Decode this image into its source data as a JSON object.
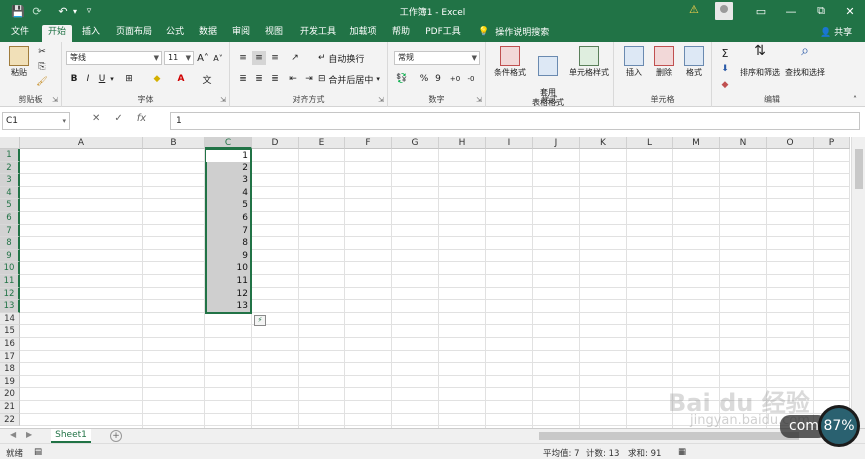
{
  "titlebar": {
    "title": "工作簿1 - Excel",
    "save_icon": "save-icon",
    "undo_icon": "undo-icon",
    "redo_icon": "redo-icon",
    "customize_icon": "customize-icon",
    "restore_label": "⧉",
    "minimize_label": "—",
    "close_label": "✕",
    "ribbon_display_label": "▭"
  },
  "tabs": {
    "items": [
      "文件",
      "开始",
      "插入",
      "页面布局",
      "公式",
      "数据",
      "审阅",
      "视图",
      "开发工具",
      "加载项",
      "帮助",
      "PDF工具"
    ],
    "tell_me": "操作说明搜索",
    "share": "共享"
  },
  "ribbon": {
    "clipboard": {
      "paste": "粘贴",
      "label": "剪贴板"
    },
    "font": {
      "name": "等线",
      "size": "11",
      "grow": "A",
      "shrink": "A",
      "bold": "B",
      "italic": "I",
      "underline": "U",
      "label": "字体"
    },
    "alignment": {
      "wrap": "自动换行",
      "merge": "合并后居中",
      "label": "对齐方式"
    },
    "number": {
      "format": "常规",
      "percent": "%",
      "comma": "9",
      "label": "数字"
    },
    "styles": {
      "conditional": "条件格式",
      "table_format": "套用\n表格格式",
      "cell_styles": "单元格样式",
      "label": "样式"
    },
    "cells": {
      "insert": "插入",
      "delete": "删除",
      "format": "格式",
      "label": "单元格"
    },
    "editing": {
      "sum": "Σ",
      "sort_filter": "排序和筛选",
      "find_select": "查找和选择",
      "label": "编辑"
    }
  },
  "formula_bar": {
    "name_box": "C1",
    "cancel": "✕",
    "enter": "✓",
    "fx": "fx",
    "value": "1"
  },
  "grid": {
    "columns": [
      "A",
      "B",
      "C",
      "D",
      "E",
      "F",
      "G",
      "H",
      "I",
      "J",
      "K",
      "L",
      "M",
      "N",
      "O",
      "P"
    ],
    "rows": [
      "1",
      "2",
      "3",
      "4",
      "5",
      "6",
      "7",
      "8",
      "9",
      "10",
      "11",
      "12",
      "13",
      "14",
      "15",
      "16",
      "17",
      "18",
      "19",
      "20",
      "21",
      "22"
    ],
    "selected_column": "C",
    "column_c_values": [
      "1",
      "2",
      "3",
      "4",
      "5",
      "6",
      "7",
      "8",
      "9",
      "10",
      "11",
      "12",
      "13"
    ]
  },
  "sheets": {
    "active": "Sheet1",
    "add": "+"
  },
  "status": {
    "ready": "就绪",
    "average": "平均值: 7",
    "count": "计数: 13",
    "sum": "求和: 91"
  },
  "watermark": {
    "brand": "Bai du 经验",
    "url": "jingyan.baidu.com",
    "com": "com",
    "zoom": "87%"
  },
  "colors": {
    "excel_green": "#217346",
    "selection_fill": "#cfcfcf"
  }
}
